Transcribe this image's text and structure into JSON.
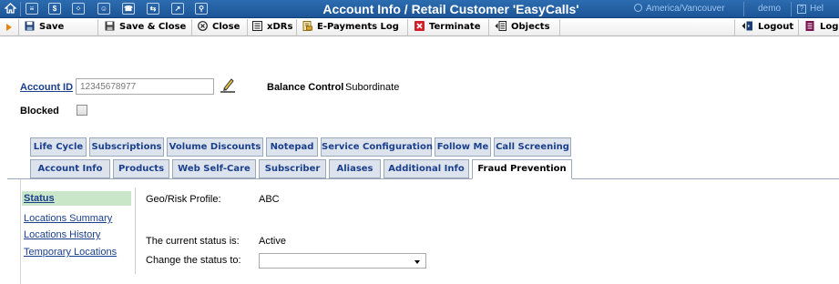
{
  "window": {
    "title": "Account Info / Retail Customer 'EasyCalls'",
    "timezone": "America/Vancouver",
    "user": "demo",
    "help_label": "Hel"
  },
  "titlebar_icons": [
    "home-icon",
    "list-icon",
    "dollar-icon",
    "grid-icon",
    "person-icon",
    "phone-icon",
    "transfer-icon",
    "chart-icon",
    "search-icon"
  ],
  "toolbar": {
    "save": "Save",
    "save_close": "Save & Close",
    "close": "Close",
    "xdrs": "xDRs",
    "epayments": "E-Payments Log",
    "terminate": "Terminate",
    "objects": "Objects",
    "logout": "Logout",
    "log": "Log"
  },
  "account": {
    "id_label": "Account ID",
    "id_value": "12345678977",
    "balance_label": "Balance Control",
    "balance_value": "Subordinate",
    "blocked_label": "Blocked",
    "blocked": false
  },
  "tabs_row1": [
    "Life Cycle",
    "Subscriptions",
    "Volume Discounts",
    "Notepad",
    "Service Configuration",
    "Follow Me",
    "Call Screening"
  ],
  "tabs_row2": [
    "Account Info",
    "Products",
    "Web Self-Care",
    "Subscriber",
    "Aliases",
    "Additional Info",
    "Fraud Prevention"
  ],
  "active_tab": "Fraud Prevention",
  "sidebar": {
    "items": [
      "Status",
      "Locations Summary",
      "Locations History",
      "Temporary Locations"
    ],
    "active": "Status"
  },
  "fraud": {
    "profile_label": "Geo/Risk Profile:",
    "profile_value": "ABC",
    "status_label": "The current status is:",
    "status_value": "Active",
    "change_label": "Change the status to:",
    "change_value": ""
  },
  "colors": {
    "titlebar": "#1d5597",
    "link": "#1a3f8c",
    "active_side": "#c9e6c9",
    "tab_bg": "#dde3ec"
  }
}
